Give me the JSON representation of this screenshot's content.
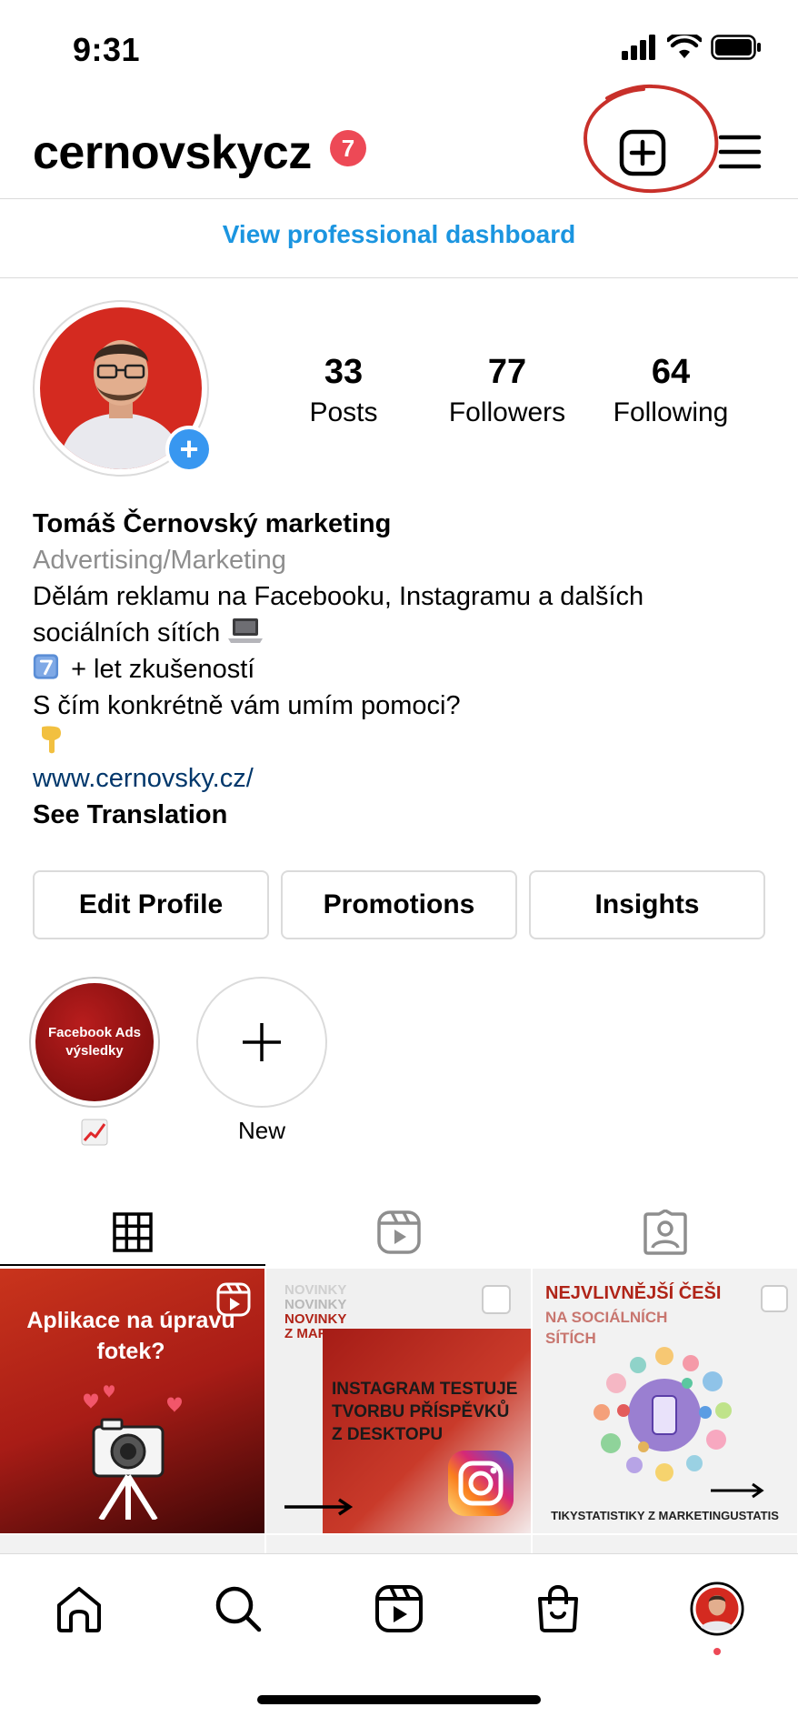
{
  "status_bar": {
    "time": "9:31"
  },
  "header": {
    "username": "cernovskycz",
    "notification_count": "7"
  },
  "dashboard_link": "View professional dashboard",
  "stats": [
    {
      "value": "33",
      "label": "Posts"
    },
    {
      "value": "77",
      "label": "Followers"
    },
    {
      "value": "64",
      "label": "Following"
    }
  ],
  "bio": {
    "name": "Tomáš Černovský marketing",
    "category": "Advertising/Marketing",
    "line1": "Dělám reklamu na Facebooku, Instagramu a dalších",
    "line2": "sociálních sítích",
    "line3": "+ let zkušeností",
    "line4": "S čím konkrétně vám umím pomoci?",
    "link": "www.cernovsky.cz/",
    "translate": "See Translation"
  },
  "buttons": {
    "edit_profile": "Edit Profile",
    "promotions": "Promotions",
    "insights": "Insights"
  },
  "highlights": [
    {
      "cover_text": "Facebook Ads výsledky",
      "label": ""
    },
    {
      "label": "New"
    }
  ],
  "posts": [
    {
      "text": "Aplikace na úpravu fotek?"
    },
    {
      "header_lines": [
        "NOVINKY",
        "NOVINKY",
        "NOVINKY",
        "Z MARKETINGU"
      ],
      "text": "INSTAGRAM TESTUJE TVORBU PŘÍSPĚVKŮ Z DESKTOPU"
    },
    {
      "title": "NEJVLIVNĚJŠÍ ČEŠI",
      "subtitle_lines": [
        "NA SOCIÁLNÍCH",
        "SÍTÍCH"
      ],
      "footer": "TIKYSTATISTIKY Z MARKETINGUSTATIS"
    }
  ],
  "colors": {
    "accent_blue": "#1b95e0",
    "badge_red": "#ed4956",
    "link_navy": "#00376b",
    "border": "#dbdbdb"
  }
}
